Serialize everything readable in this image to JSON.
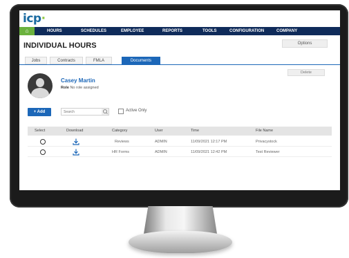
{
  "app": {
    "logo_text": "icp"
  },
  "nav": {
    "home_icon": "home-icon",
    "items": [
      "HOURS",
      "SCHEDULES",
      "EMPLOYEE",
      "REPORTS",
      "TOOLS",
      "CONFIGURATION",
      "COMPANY"
    ]
  },
  "page": {
    "title": "INDIVIDUAL HOURS",
    "options_label": "Options"
  },
  "tabs": [
    {
      "label": "Jobs",
      "active": false
    },
    {
      "label": "Contracts",
      "active": false
    },
    {
      "label": "FMLA",
      "active": false
    },
    {
      "label": "Documents",
      "active": true
    }
  ],
  "actions": {
    "delete_label": "Delete",
    "add_label": "+ Add",
    "search_placeholder": "Search",
    "active_only_label": "Active Only"
  },
  "profile": {
    "name": "Casey Martin",
    "role_label": "Role",
    "role_value": "No role assigned"
  },
  "table": {
    "columns": [
      "Select",
      "Download",
      "Category",
      "User",
      "Time",
      "File Name"
    ],
    "rows": [
      {
        "category": "Reviews",
        "user": "ADMIN",
        "time": "11/09/2021 12:17 PM",
        "file_name": "Privacystock"
      },
      {
        "category": "HR Forms",
        "user": "ADMIN",
        "time": "11/09/2021 12:42 PM",
        "file_name": "Test Reviewer"
      }
    ]
  },
  "colors": {
    "nav_bg": "#0f2b5a",
    "home_bg": "#6bb23e",
    "accent": "#1c67b8"
  }
}
